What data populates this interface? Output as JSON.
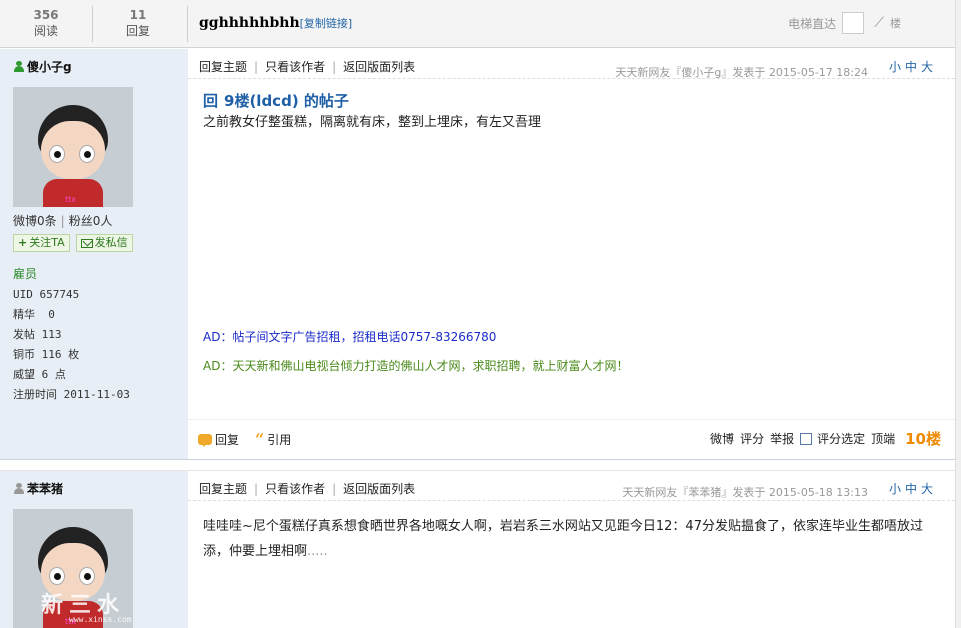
{
  "topbar": {
    "views": {
      "count": "356",
      "label": "阅读"
    },
    "replies": {
      "count": "11",
      "label": "回复"
    },
    "title": "gghhhhhbhh",
    "copy_link": "[复制链接]",
    "elevator_label": "电梯直达",
    "elevator_go": "⟋",
    "elevator_floor": "楼"
  },
  "posts": [
    {
      "author": "傻小子g",
      "online": true,
      "avatar_mark": "ttx",
      "weibo": "微博0条",
      "fans": "粉丝0人",
      "follow_label": "关注TA",
      "pm_label": "发私信",
      "group": "雇员",
      "info": [
        "UID 657745",
        "精华  0",
        "发帖 113",
        "铜币 116 枚",
        "威望 6 点",
        "注册时间 2011-11-03"
      ],
      "links": [
        "回复主题",
        "只看该作者",
        "返回版面列表"
      ],
      "meta": "天天新网友『傻小子g』发表于 2015-05-17 18:24",
      "size_controls": "小中大",
      "title_glyph": "回",
      "title": "9楼(ldcd) 的帖子",
      "body": "之前教女仔整蛋糕，隔离就有床，整到上埋床，有左又吾理",
      "ad1": "AD：帖子间文字广告招租，招租电话0757-83266780",
      "ad2": "AD：天天新和佛山电视台倾力打造的佛山人才网，求职招聘，就上财富人才网！",
      "reply_label": "回复",
      "quote_label": "引用",
      "footer_actions": [
        "微博",
        "评分",
        "举报"
      ],
      "rate_select_label": "评分选定",
      "top_label": "顶端",
      "floor": "10楼"
    },
    {
      "author": "苯苯猪",
      "online": false,
      "avatar_mark": "ttx",
      "watermark": "新三水",
      "watermark_url": "www.xinss.com",
      "links": [
        "回复主题",
        "只看该作者",
        "返回版面列表"
      ],
      "meta": "天天新网友『苯苯猪』发表于 2015-05-18 13:13",
      "size_controls": "小中大",
      "body": "哇哇哇~尼个蛋糕仔真系想食晒世界各地嘅女人啊，岩岩系三水网站又见距今日12：47分发贴揾食了，依家连毕业生都唔放过添，仲要上埋相啊",
      "ellipsis": "....."
    }
  ]
}
